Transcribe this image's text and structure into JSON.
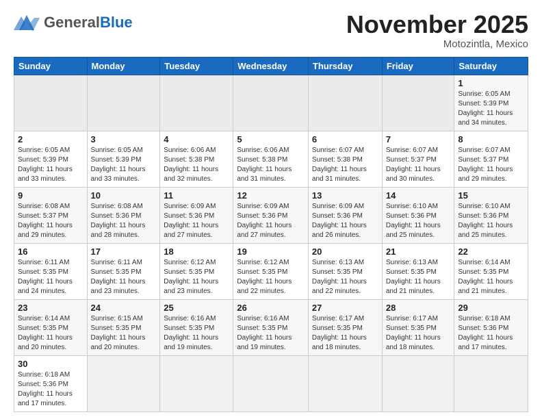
{
  "header": {
    "logo_general": "General",
    "logo_blue": "Blue",
    "month": "November 2025",
    "location": "Motozintla, Mexico"
  },
  "weekdays": [
    "Sunday",
    "Monday",
    "Tuesday",
    "Wednesday",
    "Thursday",
    "Friday",
    "Saturday"
  ],
  "weeks": [
    [
      {
        "day": "",
        "info": "",
        "empty": true
      },
      {
        "day": "",
        "info": "",
        "empty": true
      },
      {
        "day": "",
        "info": "",
        "empty": true
      },
      {
        "day": "",
        "info": "",
        "empty": true
      },
      {
        "day": "",
        "info": "",
        "empty": true
      },
      {
        "day": "",
        "info": "",
        "empty": true
      },
      {
        "day": "1",
        "info": "Sunrise: 6:05 AM\nSunset: 5:39 PM\nDaylight: 11 hours\nand 34 minutes."
      }
    ],
    [
      {
        "day": "2",
        "info": "Sunrise: 6:05 AM\nSunset: 5:39 PM\nDaylight: 11 hours\nand 33 minutes."
      },
      {
        "day": "3",
        "info": "Sunrise: 6:05 AM\nSunset: 5:39 PM\nDaylight: 11 hours\nand 33 minutes."
      },
      {
        "day": "4",
        "info": "Sunrise: 6:06 AM\nSunset: 5:38 PM\nDaylight: 11 hours\nand 32 minutes."
      },
      {
        "day": "5",
        "info": "Sunrise: 6:06 AM\nSunset: 5:38 PM\nDaylight: 11 hours\nand 31 minutes."
      },
      {
        "day": "6",
        "info": "Sunrise: 6:07 AM\nSunset: 5:38 PM\nDaylight: 11 hours\nand 31 minutes."
      },
      {
        "day": "7",
        "info": "Sunrise: 6:07 AM\nSunset: 5:37 PM\nDaylight: 11 hours\nand 30 minutes."
      },
      {
        "day": "8",
        "info": "Sunrise: 6:07 AM\nSunset: 5:37 PM\nDaylight: 11 hours\nand 29 minutes."
      }
    ],
    [
      {
        "day": "9",
        "info": "Sunrise: 6:08 AM\nSunset: 5:37 PM\nDaylight: 11 hours\nand 29 minutes."
      },
      {
        "day": "10",
        "info": "Sunrise: 6:08 AM\nSunset: 5:36 PM\nDaylight: 11 hours\nand 28 minutes."
      },
      {
        "day": "11",
        "info": "Sunrise: 6:09 AM\nSunset: 5:36 PM\nDaylight: 11 hours\nand 27 minutes."
      },
      {
        "day": "12",
        "info": "Sunrise: 6:09 AM\nSunset: 5:36 PM\nDaylight: 11 hours\nand 27 minutes."
      },
      {
        "day": "13",
        "info": "Sunrise: 6:09 AM\nSunset: 5:36 PM\nDaylight: 11 hours\nand 26 minutes."
      },
      {
        "day": "14",
        "info": "Sunrise: 6:10 AM\nSunset: 5:36 PM\nDaylight: 11 hours\nand 25 minutes."
      },
      {
        "day": "15",
        "info": "Sunrise: 6:10 AM\nSunset: 5:36 PM\nDaylight: 11 hours\nand 25 minutes."
      }
    ],
    [
      {
        "day": "16",
        "info": "Sunrise: 6:11 AM\nSunset: 5:35 PM\nDaylight: 11 hours\nand 24 minutes."
      },
      {
        "day": "17",
        "info": "Sunrise: 6:11 AM\nSunset: 5:35 PM\nDaylight: 11 hours\nand 23 minutes."
      },
      {
        "day": "18",
        "info": "Sunrise: 6:12 AM\nSunset: 5:35 PM\nDaylight: 11 hours\nand 23 minutes."
      },
      {
        "day": "19",
        "info": "Sunrise: 6:12 AM\nSunset: 5:35 PM\nDaylight: 11 hours\nand 22 minutes."
      },
      {
        "day": "20",
        "info": "Sunrise: 6:13 AM\nSunset: 5:35 PM\nDaylight: 11 hours\nand 22 minutes."
      },
      {
        "day": "21",
        "info": "Sunrise: 6:13 AM\nSunset: 5:35 PM\nDaylight: 11 hours\nand 21 minutes."
      },
      {
        "day": "22",
        "info": "Sunrise: 6:14 AM\nSunset: 5:35 PM\nDaylight: 11 hours\nand 21 minutes."
      }
    ],
    [
      {
        "day": "23",
        "info": "Sunrise: 6:14 AM\nSunset: 5:35 PM\nDaylight: 11 hours\nand 20 minutes."
      },
      {
        "day": "24",
        "info": "Sunrise: 6:15 AM\nSunset: 5:35 PM\nDaylight: 11 hours\nand 20 minutes."
      },
      {
        "day": "25",
        "info": "Sunrise: 6:16 AM\nSunset: 5:35 PM\nDaylight: 11 hours\nand 19 minutes."
      },
      {
        "day": "26",
        "info": "Sunrise: 6:16 AM\nSunset: 5:35 PM\nDaylight: 11 hours\nand 19 minutes."
      },
      {
        "day": "27",
        "info": "Sunrise: 6:17 AM\nSunset: 5:35 PM\nDaylight: 11 hours\nand 18 minutes."
      },
      {
        "day": "28",
        "info": "Sunrise: 6:17 AM\nSunset: 5:35 PM\nDaylight: 11 hours\nand 18 minutes."
      },
      {
        "day": "29",
        "info": "Sunrise: 6:18 AM\nSunset: 5:36 PM\nDaylight: 11 hours\nand 17 minutes."
      }
    ],
    [
      {
        "day": "30",
        "info": "Sunrise: 6:18 AM\nSunset: 5:36 PM\nDaylight: 11 hours\nand 17 minutes."
      },
      {
        "day": "",
        "info": "",
        "empty": true
      },
      {
        "day": "",
        "info": "",
        "empty": true
      },
      {
        "day": "",
        "info": "",
        "empty": true
      },
      {
        "day": "",
        "info": "",
        "empty": true
      },
      {
        "day": "",
        "info": "",
        "empty": true
      },
      {
        "day": "",
        "info": "",
        "empty": true
      }
    ]
  ]
}
